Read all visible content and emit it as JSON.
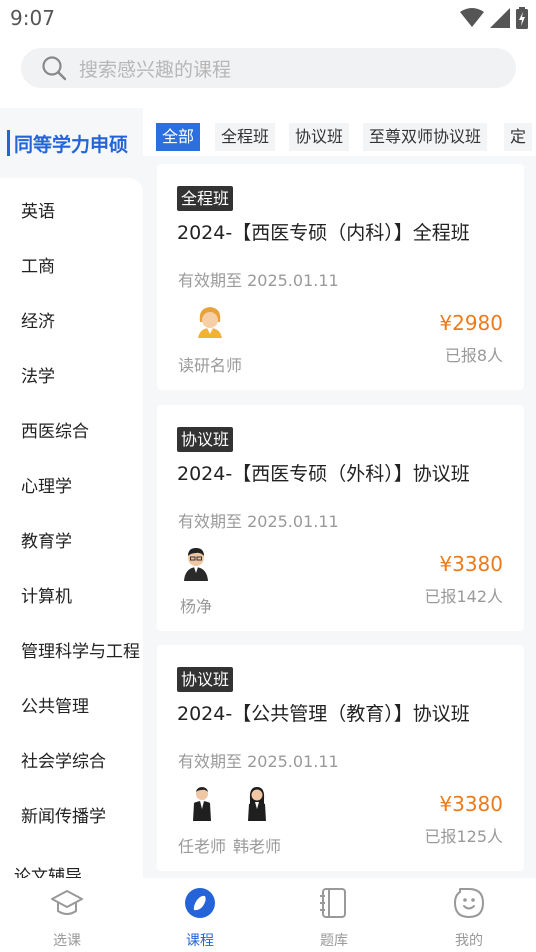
{
  "status": {
    "time": "9:07"
  },
  "search": {
    "placeholder": "搜索感兴趣的课程"
  },
  "sidebar": {
    "active": "同等学力申硕",
    "items": [
      "英语",
      "工商",
      "经济",
      "法学",
      "西医综合",
      "心理学",
      "教育学",
      "计算机",
      "管理科学与工程",
      "公共管理",
      "社会学综合",
      "新闻传播学",
      "论文辅导"
    ]
  },
  "tabs": [
    "全部",
    "全程班",
    "协议班",
    "至尊双师协议班",
    "定"
  ],
  "courses": [
    {
      "tag": "全程班",
      "title": "2024-【西医专硕（内科）】全程班",
      "validity": "有效期至 2025.01.11",
      "teachers": [
        "读研名师"
      ],
      "price": "¥2980",
      "enrolled": "已报8人"
    },
    {
      "tag": "协议班",
      "title": "2024-【西医专硕（外科）】协议班",
      "validity": "有效期至 2025.01.11",
      "teachers": [
        "杨净"
      ],
      "price": "¥3380",
      "enrolled": "已报142人"
    },
    {
      "tag": "协议班",
      "title": "2024-【公共管理（教育）】协议班",
      "validity": "有效期至 2025.01.11",
      "teachers": [
        "任老师",
        "韩老师"
      ],
      "price": "¥3380",
      "enrolled": "已报125人"
    }
  ],
  "nav": {
    "items": [
      {
        "label": "选课",
        "icon": "graduation-cap-icon"
      },
      {
        "label": "课程",
        "icon": "compass-icon"
      },
      {
        "label": "题库",
        "icon": "notebook-icon"
      },
      {
        "label": "我的",
        "icon": "smiley-icon"
      }
    ]
  },
  "colors": {
    "accent": "#2464d8",
    "price": "#ef7a1a"
  }
}
